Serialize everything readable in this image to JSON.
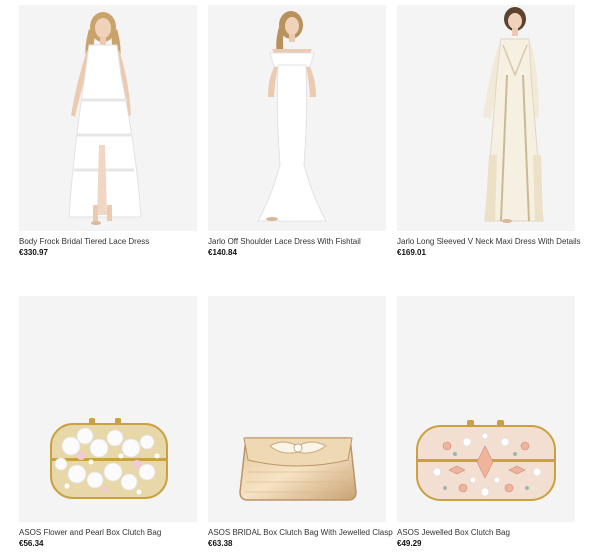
{
  "products": [
    {
      "title": "Body Frock Bridal Tiered Lace Dress",
      "price": "€330.97",
      "image": "white-lace-tiered-maxi-dress"
    },
    {
      "title": "Jarlo Off Shoulder Lace Dress With Fishtail",
      "price": "€140.84",
      "image": "white-off-shoulder-fishtail-dress"
    },
    {
      "title": "Jarlo Long Sleeved V Neck Maxi Dress With Details",
      "price": "€169.01",
      "image": "cream-long-sleeve-lace-maxi-dress"
    },
    {
      "title": "ASOS Flower and Pearl Box Clutch Bag",
      "price": "€56.34",
      "image": "flower-pearl-box-clutch"
    },
    {
      "title": "ASOS BRIDAL Box Clutch Bag With Jewelled Clasp",
      "price": "€63.38",
      "image": "gold-box-clutch-jewelled-clasp"
    },
    {
      "title": "ASOS Jewelled Box Clutch Bag",
      "price": "€49.29",
      "image": "blush-jewelled-box-clutch"
    }
  ]
}
